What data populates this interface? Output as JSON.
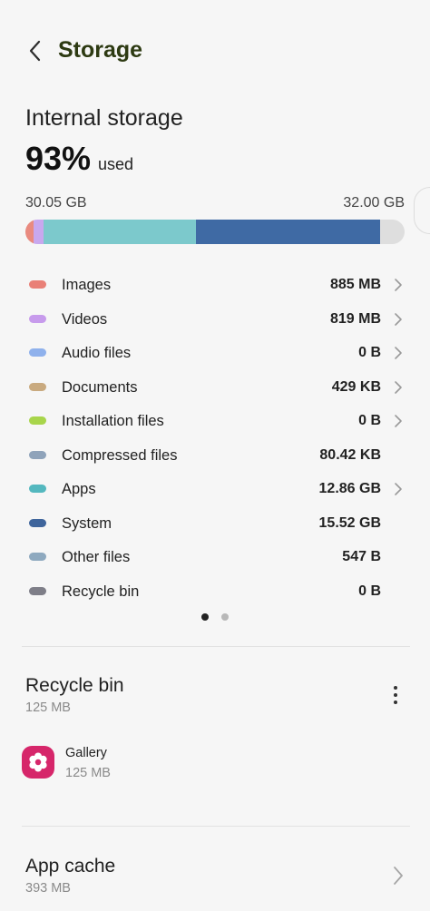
{
  "header": {
    "title": "Storage",
    "back_icon": "chevron-left-icon"
  },
  "internal": {
    "title": "Internal storage",
    "percent": "93%",
    "used_label": "used",
    "used_gb": "30.05 GB",
    "total_gb": "32.00 GB",
    "used_fraction": 0.93
  },
  "bar_segments": [
    {
      "name": "Images",
      "color": "#e98a7f",
      "fraction": 0.022
    },
    {
      "name": "Videos",
      "color": "#c8a8ee",
      "fraction": 0.026
    },
    {
      "name": "Apps",
      "color": "#7cc9cc",
      "fraction": 0.402
    },
    {
      "name": "System",
      "color": "#3f6aa4",
      "fraction": 0.485
    }
  ],
  "categories": [
    {
      "label": "Images",
      "value": "885 MB",
      "color": "#e98077",
      "chevron": true
    },
    {
      "label": "Videos",
      "value": "819 MB",
      "color": "#c79bec",
      "chevron": true
    },
    {
      "label": "Audio files",
      "value": "0 B",
      "color": "#8fb1ec",
      "chevron": true
    },
    {
      "label": "Documents",
      "value": "429 KB",
      "color": "#c9aa7f",
      "chevron": true
    },
    {
      "label": "Installation files",
      "value": "0 B",
      "color": "#a8d54b",
      "chevron": true
    },
    {
      "label": "Compressed files",
      "value": "80.42 KB",
      "color": "#8fa3ba",
      "chevron": false
    },
    {
      "label": "Apps",
      "value": "12.86 GB",
      "color": "#54b8bf",
      "chevron": true
    },
    {
      "label": "System",
      "value": "15.52 GB",
      "color": "#3f659c",
      "chevron": false
    },
    {
      "label": "Other files",
      "value": "547 B",
      "color": "#8ea9bf",
      "chevron": false
    },
    {
      "label": "Recycle bin",
      "value": "0 B",
      "color": "#7e7e88",
      "chevron": false
    }
  ],
  "pager": {
    "pages": 2,
    "active": 0
  },
  "recycle_bin": {
    "title": "Recycle bin",
    "size": "125 MB",
    "more_icon": "more-vertical-icon",
    "apps": [
      {
        "name": "Gallery",
        "size": "125 MB",
        "icon": "gallery-flower-icon",
        "icon_color": "#d6266a"
      }
    ]
  },
  "app_cache": {
    "title": "App cache",
    "size": "393 MB"
  }
}
